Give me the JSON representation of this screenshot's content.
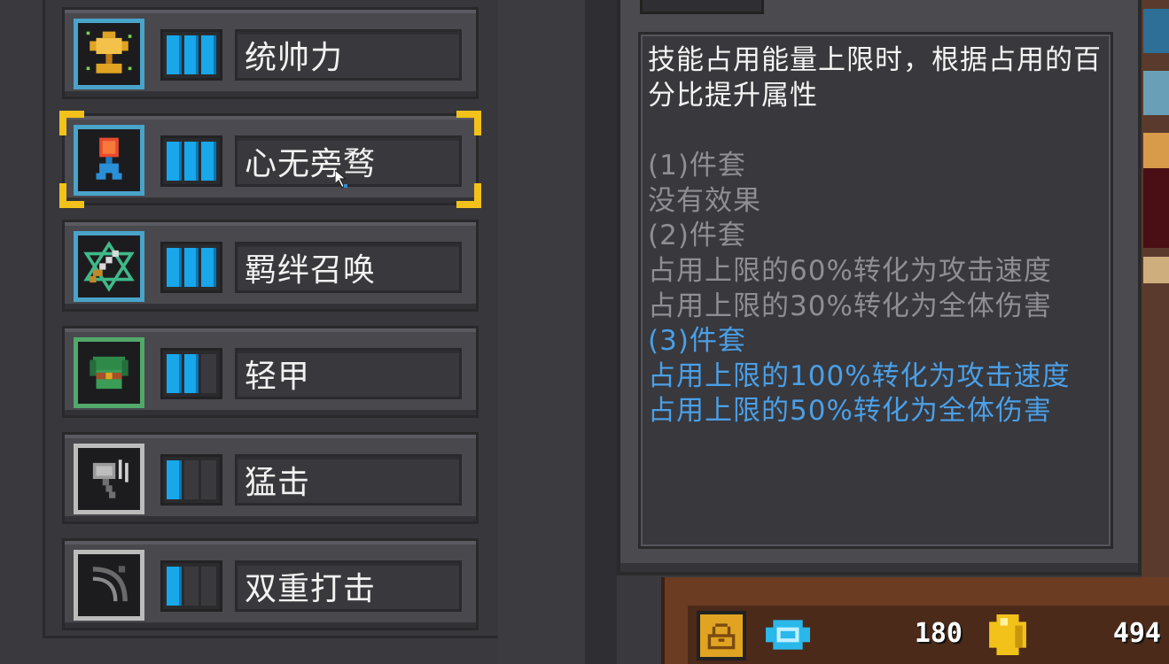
{
  "synergies": [
    {
      "name": "统帅力",
      "level_active": 3,
      "level_max": 3,
      "icon": "trophy-icon",
      "tier": "blue"
    },
    {
      "name": "心无旁骛",
      "level_active": 3,
      "level_max": 3,
      "icon": "focus-heart-icon",
      "tier": "blue"
    },
    {
      "name": "羁绊召唤",
      "level_active": 3,
      "level_max": 3,
      "icon": "summon-sword-icon",
      "tier": "blue"
    },
    {
      "name": "轻甲",
      "level_active": 2,
      "level_max": 3,
      "icon": "light-armor-icon",
      "tier": "green"
    },
    {
      "name": "猛击",
      "level_active": 1,
      "level_max": 3,
      "icon": "hammer-icon",
      "tier": "grey"
    },
    {
      "name": "双重打击",
      "level_active": 1,
      "level_max": 3,
      "icon": "double-strike-icon",
      "tier": "grey"
    }
  ],
  "selected_index": 1,
  "tooltip": {
    "description": "技能占用能量上限时，根据占用的百分比提升属性",
    "set1_title": "(1)件套",
    "set1_effect": "没有效果",
    "set2_title": "(2)件套",
    "set2_effect1": "占用上限的60%转化为攻击速度",
    "set2_effect2": "占用上限的30%转化为全体伤害",
    "set3_title": "(3)件套",
    "set3_effect1": "占用上限的100%转化为攻击速度",
    "set3_effect2": "占用上限的50%转化为全体伤害"
  },
  "currency": {
    "gems": "180",
    "coins": "494"
  },
  "colors": {
    "active_bar": "#18a7ea",
    "inactive_text": "#8e8e93",
    "active_set_text": "#4b9fe6",
    "selection_corner": "#f2c21b"
  }
}
